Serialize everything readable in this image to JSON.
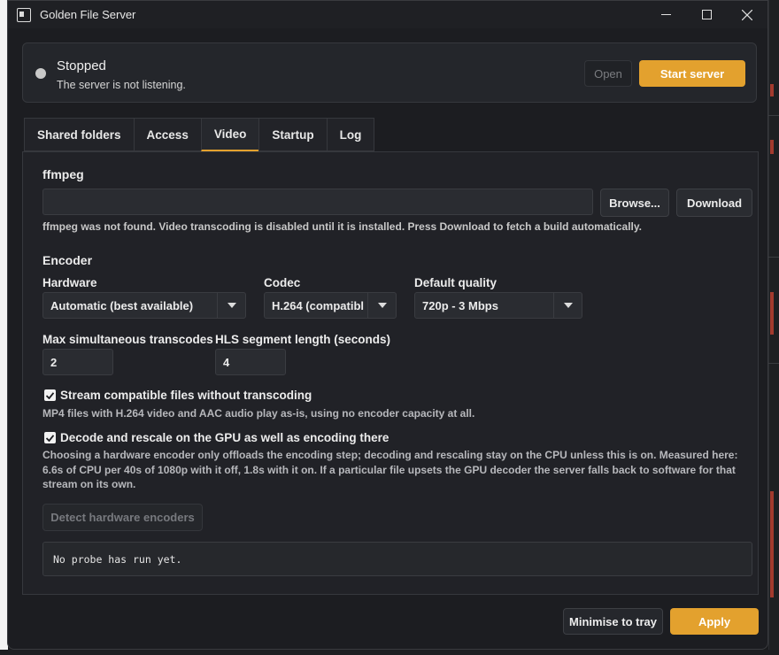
{
  "window": {
    "title": "Golden File Server"
  },
  "status": {
    "title": "Stopped",
    "subtitle": "The server is not listening.",
    "open_label": "Open",
    "start_label": "Start server"
  },
  "tabs": [
    {
      "label": "Shared folders"
    },
    {
      "label": "Access"
    },
    {
      "label": "Video",
      "active": true
    },
    {
      "label": "Startup"
    },
    {
      "label": "Log"
    }
  ],
  "video": {
    "ffmpeg_heading": "ffmpeg",
    "ffmpeg_path": "",
    "browse_label": "Browse...",
    "download_label": "Download",
    "ffmpeg_hint": "ffmpeg was not found. Video transcoding is disabled until it is installed. Press Download to fetch a build automatically.",
    "encoder_heading": "Encoder",
    "hardware_label": "Hardware",
    "hardware_value": "Automatic (best available)",
    "codec_label": "Codec",
    "codec_value": "H.264 (compatibl",
    "quality_label": "Default quality",
    "quality_value": "720p - 3 Mbps",
    "max_label": "Max simultaneous transcodes",
    "max_value": "2",
    "hls_label": "HLS segment length (seconds)",
    "hls_value": "4",
    "stream_label": "Stream compatible files without transcoding",
    "stream_checked": true,
    "stream_hint": "MP4 files with H.264 video and AAC audio play as-is, using no encoder capacity at all.",
    "gpu_label": "Decode and rescale on the GPU as well as encoding there",
    "gpu_checked": true,
    "gpu_hint": "Choosing a hardware encoder only offloads the encoding step; decoding and rescaling stay on the CPU unless this is on. Measured here: 6.6s of CPU per 40s of 1080p with it off, 1.8s with it on. If a particular file upsets the GPU decoder the server falls back to software for that stream on its own.",
    "detect_label": "Detect hardware encoders",
    "probe_output": "No probe has run yet."
  },
  "footer": {
    "tray_label": "Minimise to tray",
    "apply_label": "Apply"
  },
  "colors": {
    "accent": "#e3a12e",
    "background": "#1c1d21",
    "status_idle": "#c9c9c9"
  }
}
